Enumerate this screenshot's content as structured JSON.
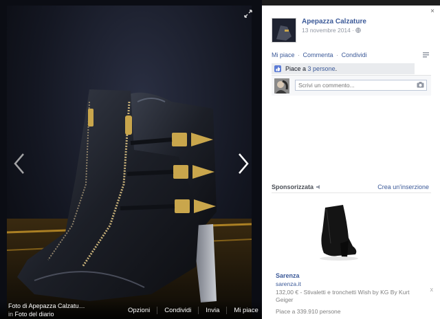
{
  "photo": {
    "caption_title": "Foto di Apepazza Calzatu…",
    "caption_in": "in",
    "caption_album": "Foto del diario",
    "actions": [
      "Opzioni",
      "Condividi",
      "Invia",
      "Mi piace"
    ]
  },
  "post": {
    "page_name": "Apepazza Calzature",
    "date": "13 novembre 2014 ·",
    "actions": {
      "like": "Mi piace",
      "comment": "Commenta",
      "share": "Condividi",
      "sep": "·"
    },
    "likes_prefix": "Piace a",
    "likes_count": "3 persone",
    "likes_suffix": ".",
    "comment_placeholder": "Scrivi un commento..."
  },
  "sponsored": {
    "label": "Sponsorizzata",
    "create_ad": "Crea un'inserzione",
    "ad_title": "Sarenza",
    "ad_url": "sarenza.it",
    "ad_desc": "132,00 € - Stivaletti e tronchetti Wish by KG By Kurt Geiger",
    "ad_likes": "Piace a 339.910 persone",
    "close": "x"
  },
  "panel": {
    "close": "×"
  },
  "icons": {
    "expand": "expand-icon",
    "prev": "chevron-left-icon",
    "next": "chevron-right-icon",
    "globe": "globe-icon",
    "thumb": "thumbs-up-icon",
    "camera": "camera-icon",
    "menu": "menu-icon"
  },
  "colors": {
    "link": "#3b5998",
    "stage": "#0b0d14",
    "muted": "#9197a3"
  }
}
